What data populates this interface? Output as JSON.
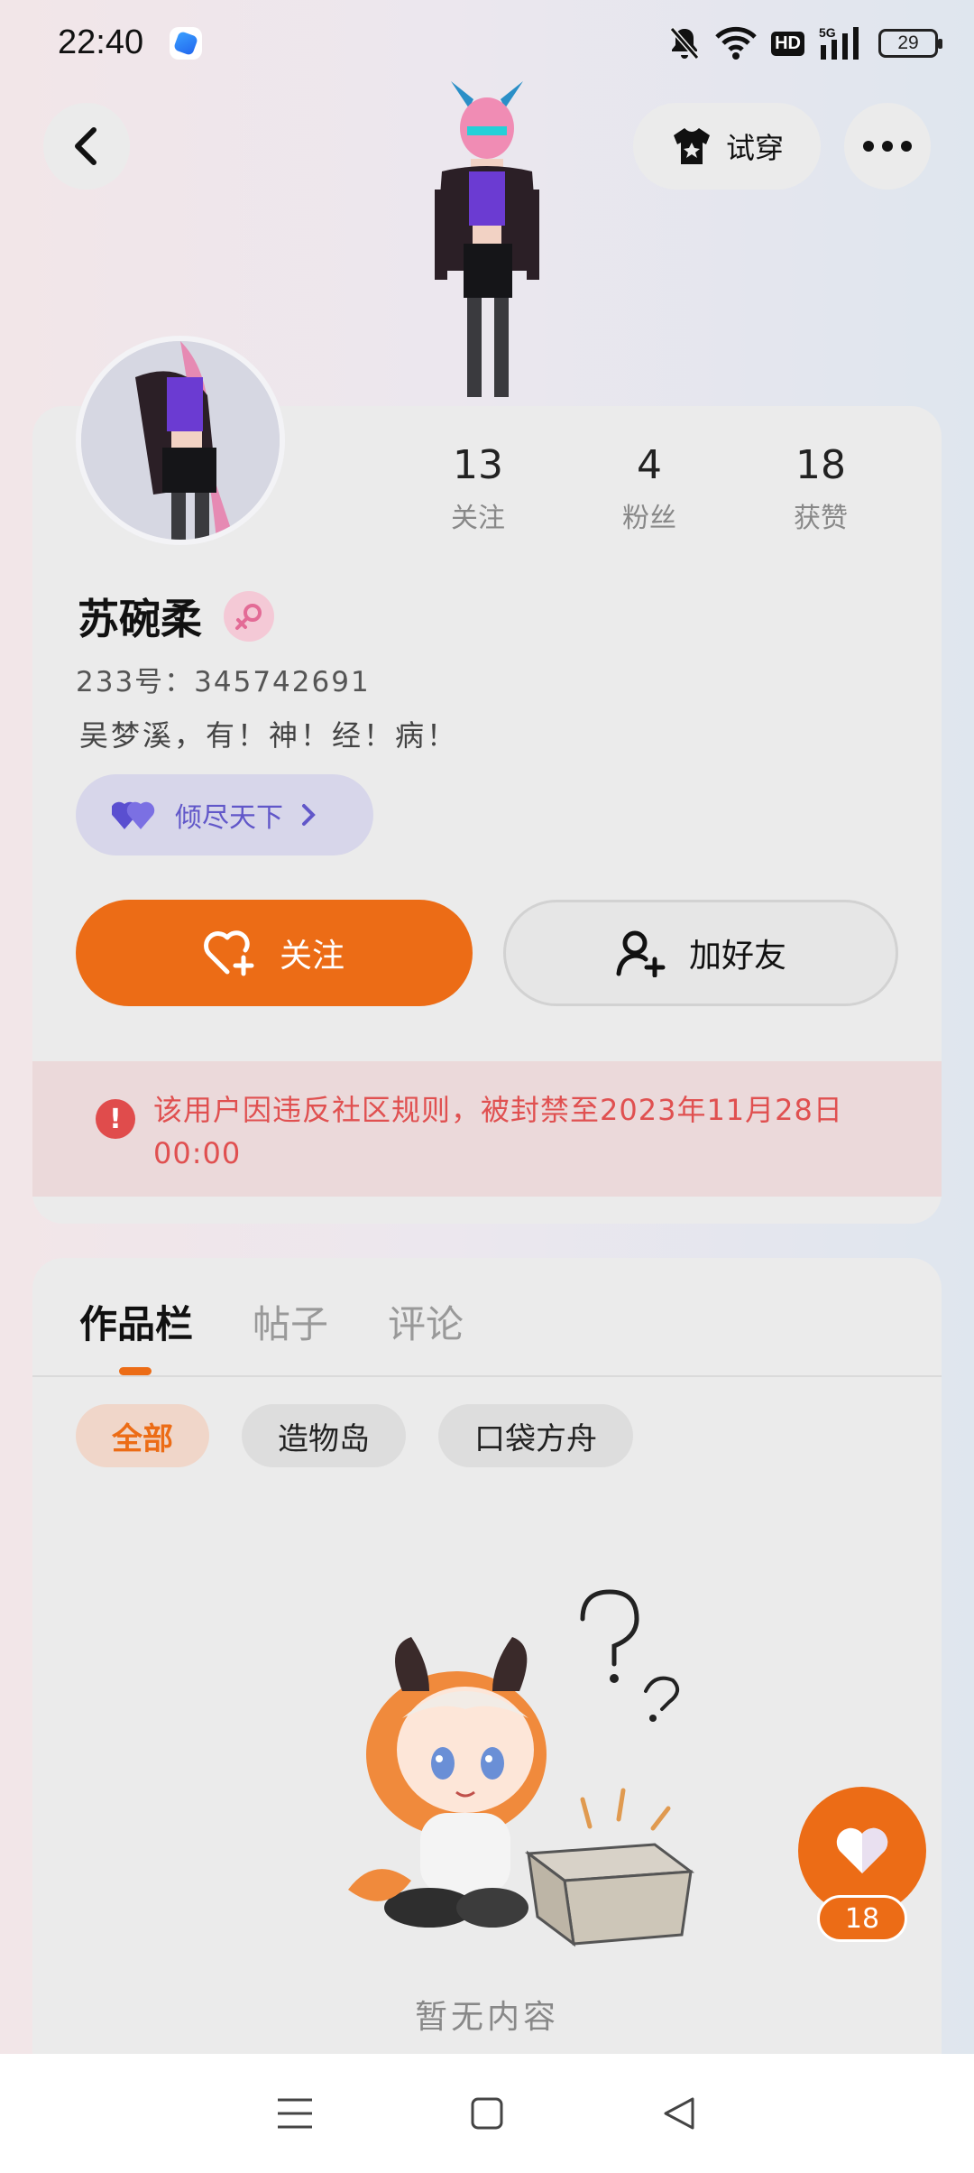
{
  "status_bar": {
    "time": "22:40",
    "network": "5G",
    "hd": "HD",
    "battery": "29",
    "icons": [
      "app-icon",
      "mute-icon",
      "wifi-icon",
      "hd-icon",
      "signal-icon",
      "battery-icon"
    ]
  },
  "header": {
    "tryon_label": "试穿",
    "icons": [
      "back-icon",
      "shirt-icon",
      "more-icon"
    ]
  },
  "profile": {
    "stats": [
      {
        "value": "13",
        "label": "关注"
      },
      {
        "value": "4",
        "label": "粉丝"
      },
      {
        "value": "18",
        "label": "获赞"
      }
    ],
    "username": "苏碗柔",
    "gender": "female",
    "uid": "233号：345742691",
    "bio": "吴梦溪，有！神！经！病！",
    "guild": "倾尽天下",
    "follow_label": "关注",
    "add_friend_label": "加好友",
    "ban_notice": "该用户因违反社区规则，被封禁至2023年11月28日00:00"
  },
  "content": {
    "tabs": [
      "作品栏",
      "帖子",
      "评论"
    ],
    "chips": [
      "全部",
      "造物岛",
      "口袋方舟"
    ],
    "empty_text": "暂无内容"
  },
  "like": {
    "count": "18"
  },
  "colors": {
    "accent": "#ec6c16",
    "danger": "#e05050",
    "guild": "#6157c9"
  }
}
